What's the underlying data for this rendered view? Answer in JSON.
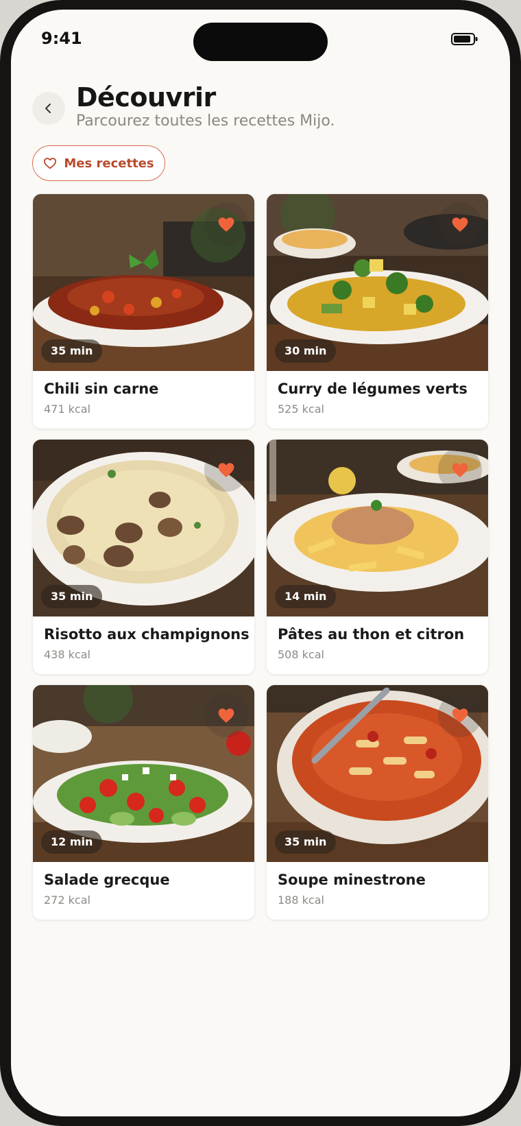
{
  "status_bar": {
    "time": "9:41"
  },
  "header": {
    "title": "Découvrir",
    "subtitle": "Parcourez toutes les recettes Mijo."
  },
  "filter_chip": {
    "label": "Mes recettes"
  },
  "colors": {
    "accent": "#b84a2d",
    "favorite": "#f0643c",
    "background": "#fbf9f6"
  },
  "recipes": [
    {
      "name": "Chili sin carne",
      "kcal": "471 kcal",
      "time": "35 min",
      "favorite": true
    },
    {
      "name": "Curry de légumes verts",
      "kcal": "525 kcal",
      "time": "30 min",
      "favorite": true
    },
    {
      "name": "Risotto aux champignons",
      "kcal": "438 kcal",
      "time": "35 min",
      "favorite": true
    },
    {
      "name": "Pâtes au thon et citron",
      "kcal": "508 kcal",
      "time": "14 min",
      "favorite": true
    },
    {
      "name": "Salade grecque",
      "kcal": "272 kcal",
      "time": "12 min",
      "favorite": true
    },
    {
      "name": "Soupe minestrone",
      "kcal": "188 kcal",
      "time": "35 min",
      "favorite": true
    }
  ]
}
